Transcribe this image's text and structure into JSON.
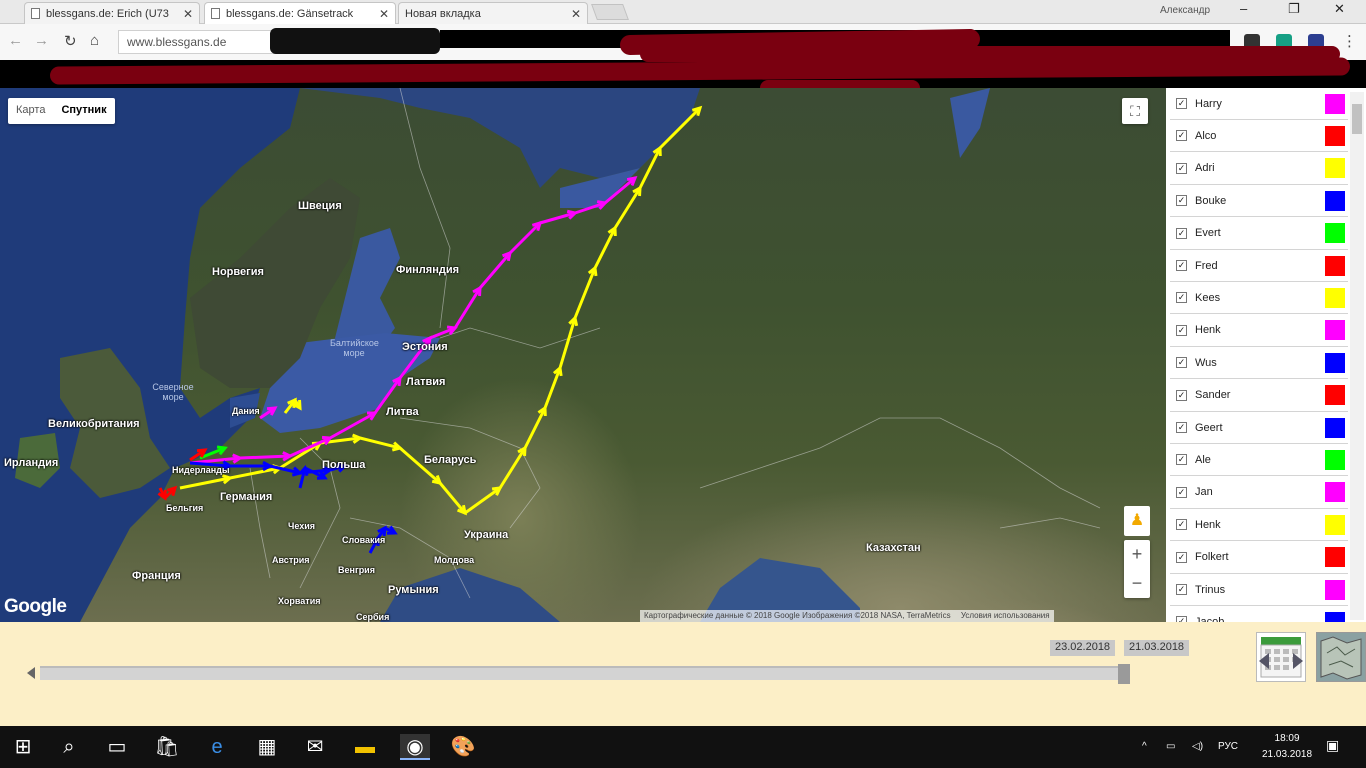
{
  "browser": {
    "tabs": [
      {
        "title": "blessgans.de: Erich (U73"
      },
      {
        "title": "blessgans.de: Gänsetrack"
      },
      {
        "title": "Новая вкладка"
      }
    ],
    "user_name": "Александр",
    "url": "www.blessgans.de"
  },
  "map": {
    "type_buttons": [
      "Карта",
      "Спутник"
    ],
    "active_type": "Спутник",
    "logo": "Google",
    "attribution": "Картографические данные © 2018 Google Изображения ©2018 NASA, TerraMetrics",
    "terms": "Условия использования",
    "labels": {
      "sweden": "Швеция",
      "norway": "Норвегия",
      "finland": "Финляндия",
      "estonia": "Эстония",
      "latvia": "Латвия",
      "lithuania": "Литва",
      "belarus": "Беларусь",
      "poland": "Польша",
      "germany": "Германия",
      "ukraine": "Украина",
      "kazakhstan": "Казахстан",
      "uk": "Великобритания",
      "ireland": "Ирландия",
      "france": "Франция",
      "czech": "Чехия",
      "austria": "Австрия",
      "hungary": "Венгрия",
      "romania": "Румыния",
      "croatia": "Хорватия",
      "serbia": "Сербия",
      "moldova": "Молдова",
      "belgium": "Бельгия",
      "netherlands": "Нидерланды",
      "denmark": "Дания",
      "slovakia": "Словакия",
      "baltic_sea": "Балтийское море",
      "north_sea": "Северное море"
    }
  },
  "birds": [
    {
      "name": "Harry",
      "color": "#ff00ff"
    },
    {
      "name": "Alco",
      "color": "#ff0000"
    },
    {
      "name": "Adri",
      "color": "#ffff00"
    },
    {
      "name": "Bouke",
      "color": "#0000ff"
    },
    {
      "name": "Evert",
      "color": "#00ff00"
    },
    {
      "name": "Fred",
      "color": "#ff0000"
    },
    {
      "name": "Kees",
      "color": "#ffff00"
    },
    {
      "name": "Henk",
      "color": "#ff00ff"
    },
    {
      "name": "Wus",
      "color": "#0000ff"
    },
    {
      "name": "Sander",
      "color": "#ff0000"
    },
    {
      "name": "Geert",
      "color": "#0000ff"
    },
    {
      "name": "Ale",
      "color": "#00ff00"
    },
    {
      "name": "Jan",
      "color": "#ff00ff"
    },
    {
      "name": "Henk",
      "color": "#ffff00"
    },
    {
      "name": "Folkert",
      "color": "#ff0000"
    },
    {
      "name": "Trinus",
      "color": "#ff00ff"
    },
    {
      "name": "Jacob",
      "color": "#0000ff"
    }
  ],
  "timeline": {
    "start_date": "23.02.2018",
    "end_date": "21.03.2018"
  },
  "taskbar": {
    "lang": "РУС",
    "time": "18:09",
    "date": "21.03.2018"
  }
}
